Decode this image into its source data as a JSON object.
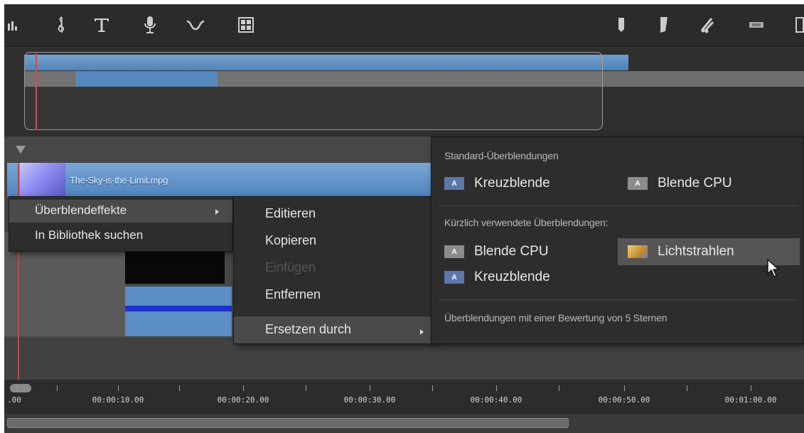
{
  "toolbar": {
    "tools_left": [
      "audio-bars-icon",
      "music-note-icon",
      "title-text-icon",
      "microphone-icon",
      "curve-icon",
      "grid-icon"
    ],
    "tools_right": [
      "marker-left-icon",
      "marker-right-icon",
      "scissors-icon",
      "film-icon",
      "panel-icon"
    ]
  },
  "clip": {
    "name": "The-Sky-is-the-Limit.mpg"
  },
  "context_menu": {
    "items": [
      {
        "label": "Überblendeffekte",
        "has_submenu": true,
        "highlighted": true
      },
      {
        "label": "In Bibliothek suchen",
        "has_submenu": false,
        "highlighted": false
      }
    ]
  },
  "submenu": {
    "items": [
      {
        "label": "Editieren",
        "disabled": false
      },
      {
        "label": "Kopieren",
        "disabled": false
      },
      {
        "label": "Einfügen",
        "disabled": true
      },
      {
        "label": "Entfernen",
        "disabled": false
      },
      {
        "label": "Ersetzen durch",
        "disabled": false,
        "has_submenu": true,
        "highlighted": true
      }
    ]
  },
  "transitions_panel": {
    "standard_title": "Standard-Überblendungen",
    "standard": [
      {
        "label": "Kreuzblende",
        "icon": "crossfade-icon"
      },
      {
        "label": "Blende CPU",
        "icon": "fade-cpu-icon"
      }
    ],
    "recent_title": "Kürzlich verwendete Überblendungen:",
    "recent": [
      {
        "label": "Blende CPU",
        "icon": "fade-cpu-icon"
      },
      {
        "label": "Lichtstrahlen",
        "icon": "light-rays-icon",
        "hovered": true
      },
      {
        "label": "Kreuzblende",
        "icon": "crossfade-icon"
      }
    ],
    "rated_label": "Überblendungen mit einer Bewertung von 5 Sternen"
  },
  "ruler": {
    "labels": [
      ".00",
      "00:00:10.00",
      "00:00:20.00",
      "00:00:30.00",
      "00:00:40.00",
      "00:00:50.00",
      "00:01:00.00"
    ]
  },
  "colors": {
    "clip_blue": "#5a8ec4",
    "playhead": "#b64a4a",
    "menu_bg": "#2d2d2d",
    "highlight": "#4a4a4a"
  }
}
